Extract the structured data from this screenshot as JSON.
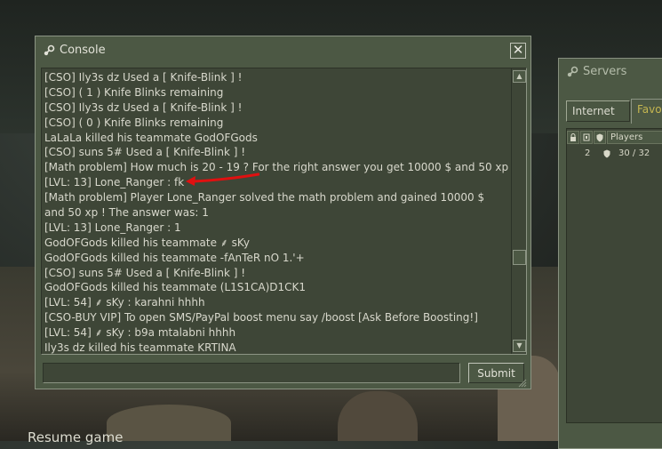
{
  "console": {
    "title": "Console",
    "lines": [
      "[CSO] Ily3s dz Used a [ Knife-Blink ] !",
      "[CSO] ( 1 ) Knife Blinks remaining",
      "[CSO] Ily3s dz Used a [ Knife-Blink ] !",
      "[CSO] ( 0 ) Knife Blinks remaining",
      "LaLaLa killed his teammate GodOFGods",
      "[CSO] suns 5# Used a [ Knife-Blink ] !",
      "[Math problem] How much is 20 - 19 ? For the right answer you get 10000 $ and 50 xp",
      "[LVL: 13] Lone_Ranger : fk",
      "[Math problem] Player Lone_Ranger solved the math problem and gained 10000 $ and 50 xp ! The answer was: 1",
      "[LVL: 13] Lone_Ranger : 1",
      "GodOFGods killed his teammate ⸙ sKy",
      "GodOFGods killed his teammate -fAnTeR nO 1.'+",
      "[CSO] suns 5# Used a [ Knife-Blink ] !",
      "GodOFGods killed his teammate (L1S1CA)D1CK1",
      "[LVL: 54] ⸙ sKy : karahni hhhh",
      "[CSO-BUY VIP] To open SMS/PayPal boost menu say /boost [Ask Before Boosting!]",
      "[LVL: 54] ⸙ sKy : b9a mtalabni hhhh",
      "Ily3s dz killed his teammate KRTINA"
    ],
    "input_value": "",
    "submit_label": "Submit",
    "close_glyph": "✕",
    "scroll_up_glyph": "▲",
    "scroll_down_glyph": "▼"
  },
  "servers": {
    "title": "Servers",
    "tabs": [
      "Internet",
      "Favor"
    ],
    "columns": [
      "Players"
    ],
    "row": {
      "count": "2",
      "players": "30 / 32"
    }
  },
  "background": {
    "resume_text": "Resume game"
  },
  "colors": {
    "panel": "#4c5844",
    "inset": "#3e4637",
    "text": "#d8d8cc",
    "tab_accent": "#c4b550",
    "annotation_arrow": "#e01010"
  },
  "icons": {
    "console_title": "steam-icon",
    "servers_title": "steam-icon",
    "lock_column": "lock-icon",
    "shield_column": "shield-icon"
  }
}
